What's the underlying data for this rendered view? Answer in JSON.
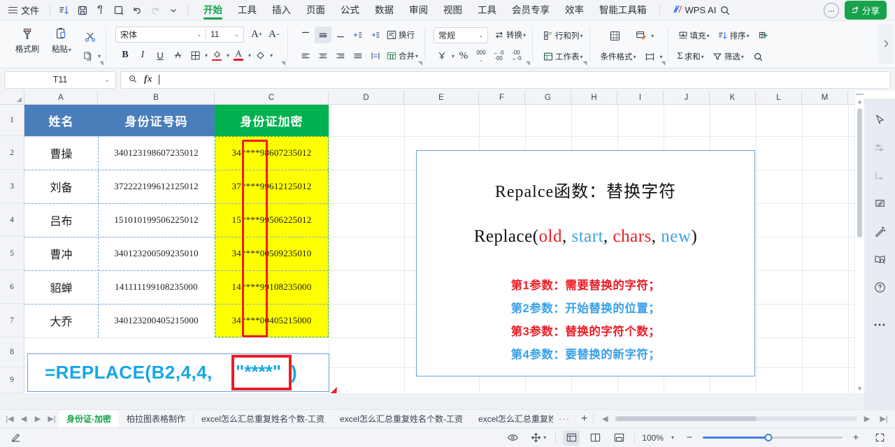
{
  "menubar": {
    "file_label": "文件",
    "quick_icons": [
      "sort-icon",
      "save-icon",
      "print-icon",
      "print-preview-icon",
      "undo-icon",
      "redo-icon",
      "chevron-down-icon"
    ],
    "tabs": [
      {
        "label": "开始",
        "active": true
      },
      {
        "label": "工具",
        "active": false
      },
      {
        "label": "插入",
        "active": false
      },
      {
        "label": "页面",
        "active": false
      },
      {
        "label": "公式",
        "active": false
      },
      {
        "label": "数据",
        "active": false
      },
      {
        "label": "审阅",
        "active": false
      },
      {
        "label": "视图",
        "active": false
      },
      {
        "label": "工具",
        "active": false
      },
      {
        "label": "会员专享",
        "active": false
      },
      {
        "label": "效率",
        "active": false
      },
      {
        "label": "智能工具箱",
        "active": false
      }
    ],
    "wps_ai_label": "WPS AI",
    "search_icon": "search-icon",
    "more_icon": "more-circle-icon",
    "share_label": "分享"
  },
  "ribbon": {
    "clipboard": {
      "format_painter": "格式刷",
      "paste": "粘贴",
      "cut_icon": "scissors-icon",
      "copy_icon": "copy-icon"
    },
    "font": {
      "family": "宋体",
      "size": "11",
      "grow_icon": "increase-font-icon",
      "shrink_icon": "decrease-font-icon",
      "bold": "B",
      "italic": "I",
      "underline": "U",
      "strike_icon": "strikethrough-icon",
      "borders_icon": "borders-icon",
      "fill_icon": "fill-color-icon",
      "fontcolor_icon": "font-color-icon",
      "clear_icon": "clear-format-icon"
    },
    "align": {
      "wrap_label": "换行",
      "merge_label": "合并",
      "top_icon": "align-top-icon",
      "middle_icon": "align-middle-icon",
      "bottom_icon": "align-bottom-icon",
      "indent_dec_icon": "decrease-indent-icon",
      "indent_inc_icon": "increase-indent-icon",
      "left_icon": "align-left-icon",
      "center_icon": "align-center-icon",
      "right_icon": "align-right-icon",
      "justify_icon": "justify-icon",
      "orientation_icon": "text-orientation-icon"
    },
    "number": {
      "format": "常规",
      "convert_label": "转换",
      "currency_icon": "currency-icon",
      "percent_icon": "percent-icon",
      "comma_icon": "comma-style-icon",
      "dec_increase_icon": "increase-decimal-icon",
      "dec_decrease_icon": "decrease-decimal-icon"
    },
    "cells": {
      "rows_cols": "行和列",
      "worksheet": "工作表",
      "cond_format": "条件格式",
      "cell_style_icon": "cell-style-icon",
      "border_style_icon": "table-style-icon",
      "frame_icon": "frame-icon"
    },
    "editing": {
      "fill": "填充",
      "sum": "求和",
      "sort": "排序",
      "filter": "筛选",
      "table_icon": "table-insert-icon",
      "find_icon": "find-icon"
    },
    "expand_icon": "chevron-right-icon"
  },
  "formula_bar": {
    "name_box": "T11",
    "search_icon": "search-icon",
    "fx_label": "fx",
    "value": ""
  },
  "grid": {
    "columns": [
      "A",
      "B",
      "C",
      "D",
      "E",
      "F",
      "G",
      "H",
      "I",
      "J",
      "K",
      "L",
      "M"
    ],
    "rows": [
      "1",
      "2",
      "3",
      "4",
      "5",
      "6",
      "7",
      "8",
      "9"
    ],
    "headers": {
      "a": "姓名",
      "b": "身份证号码",
      "c": "身份证加密"
    },
    "header_colors": {
      "name_blue": "#4A7EBB",
      "encrypt_green": "#00B14F",
      "highlight_yellow": "#FFFF00"
    },
    "rows_data": [
      {
        "name": "曹操",
        "id": "340123198607235012",
        "enc": "34****98607235012"
      },
      {
        "name": "刘备",
        "id": "372222199612125012",
        "enc": "37****99612125012"
      },
      {
        "name": "吕布",
        "id": "151010199506225012",
        "enc": "15****99506225012"
      },
      {
        "name": "曹冲",
        "id": "340123200509235010",
        "enc": "34****00509235010"
      },
      {
        "name": "貂蝉",
        "id": "141111199108235000",
        "enc": "14****99108235000"
      },
      {
        "name": "大乔",
        "id": "340123200405215000",
        "enc": "34****00405215000"
      }
    ],
    "formula_callout": {
      "text": "=REPLACE(B2,4,4,",
      "highlight": "\"****\"",
      "tail": ")",
      "color": "#16A7E8"
    }
  },
  "info_panel": {
    "title": "Repalce函数：替换字符",
    "signature": {
      "fn": "Replace(",
      "p1": "old",
      "sep1": ", ",
      "p2": "start",
      "sep2": ", ",
      "p3": "chars",
      "sep3": ", ",
      "p4": "new",
      "close": ")"
    },
    "params": [
      {
        "text": "第1参数：需要替换的字符；",
        "color": "red"
      },
      {
        "text": "第2参数：开始替换的位置；",
        "color": "blue"
      },
      {
        "text": "第3参数：替换的字符个数；",
        "color": "red"
      },
      {
        "text": "第4参数：要替换的新字符；",
        "color": "blue"
      }
    ]
  },
  "right_rail": {
    "items": [
      {
        "icon": "cursor-select-icon",
        "dim": false
      },
      {
        "icon": "sliders-icon",
        "dim": true
      },
      {
        "icon": "wrap-text-icon",
        "dim": true
      },
      {
        "icon": "feather-write-icon",
        "dim": false
      },
      {
        "icon": "magic-wand-icon",
        "dim": false
      },
      {
        "icon": "book-search-icon",
        "dim": false
      },
      {
        "icon": "help-circle-icon",
        "dim": false
      },
      {
        "icon": "more-dots-icon",
        "dim": false
      }
    ]
  },
  "sheet_tabs": {
    "nav": [
      "first-sheet-icon",
      "prev-sheet-icon",
      "next-sheet-icon",
      "last-sheet-icon"
    ],
    "tabs": [
      {
        "label": "身份证-加密",
        "active": true
      },
      {
        "label": "柏拉图表格制作",
        "active": false
      },
      {
        "label": "excel怎么汇总重复姓名个数-工资",
        "active": false
      },
      {
        "label": "excel怎么汇总重复姓名个数-工资",
        "active": false
      },
      {
        "label": "excel怎么汇总重复姓",
        "active": false
      }
    ],
    "overflow_label": "···",
    "add_label": "+"
  },
  "status_bar": {
    "left_icon": "wps-pen-icon",
    "eye_icon": "eye-icon",
    "layout_icon": "page-layout-icon",
    "view_normal_icon": "normal-view-icon",
    "view_page_icon": "page-break-view-icon",
    "view_read_icon": "reading-view-icon",
    "zoom_label": "100%",
    "zoom_out": "−",
    "zoom_in": "+",
    "fullscreen_icon": "fullscreen-icon"
  }
}
